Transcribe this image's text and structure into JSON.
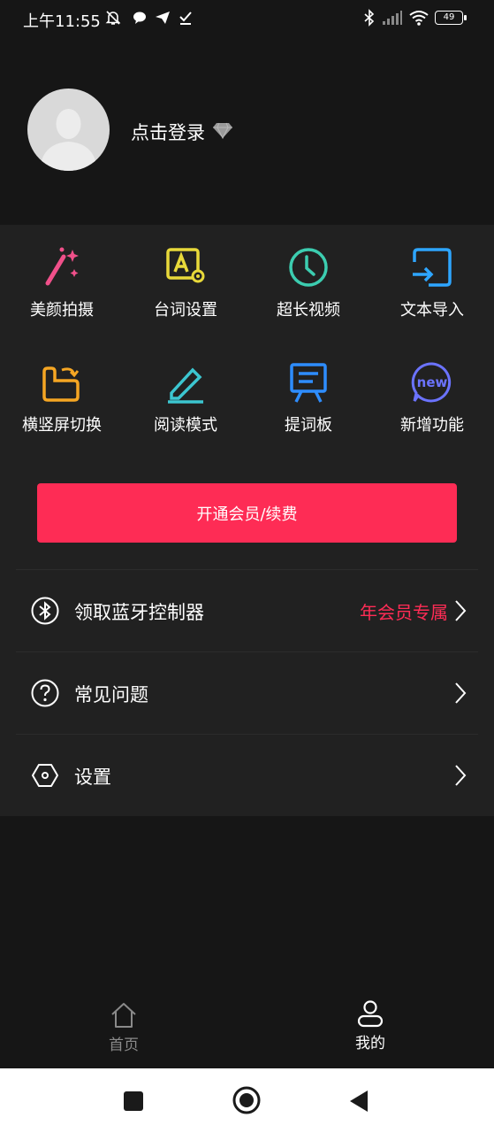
{
  "status_bar": {
    "time": "上午11:55",
    "battery": "49",
    "icons": [
      "mute-icon",
      "chat-icon",
      "send-icon",
      "check-icon",
      "bluetooth-icon",
      "signal-icon",
      "wifi-icon",
      "battery-icon"
    ]
  },
  "profile": {
    "login_text": "点击登录",
    "badge_icon": "diamond-icon"
  },
  "features": [
    {
      "label": "美颜拍摄",
      "icon": "magic-wand-icon",
      "color": "#f0508a"
    },
    {
      "label": "台词设置",
      "icon": "text-settings-icon",
      "color": "#e8d93a"
    },
    {
      "label": "超长视频",
      "icon": "clock-icon",
      "color": "#3ccdb0"
    },
    {
      "label": "文本导入",
      "icon": "import-icon",
      "color": "#2ea6ff"
    },
    {
      "label": "横竖屏切换",
      "icon": "rotate-screen-icon",
      "color": "#f5a623"
    },
    {
      "label": "阅读模式",
      "icon": "pencil-icon",
      "color": "#3cc6d0"
    },
    {
      "label": "提词板",
      "icon": "board-icon",
      "color": "#2e8dff"
    },
    {
      "label": "新增功能",
      "icon": "new-icon",
      "color": "#6b73ff",
      "badge": "new"
    }
  ],
  "vip_button": "开通会员/续费",
  "menu": [
    {
      "label": "领取蓝牙控制器",
      "tag": "年会员专属",
      "icon": "bluetooth-circle-icon"
    },
    {
      "label": "常见问题",
      "tag": "",
      "icon": "question-icon"
    },
    {
      "label": "设置",
      "tag": "",
      "icon": "hexagon-settings-icon"
    }
  ],
  "bottom_nav": [
    {
      "label": "首页",
      "icon": "home-icon",
      "active": false
    },
    {
      "label": "我的",
      "icon": "profile-icon",
      "active": true
    }
  ],
  "colors": {
    "accent": "#fe2c55",
    "background": "#161616",
    "panel": "#212121"
  }
}
